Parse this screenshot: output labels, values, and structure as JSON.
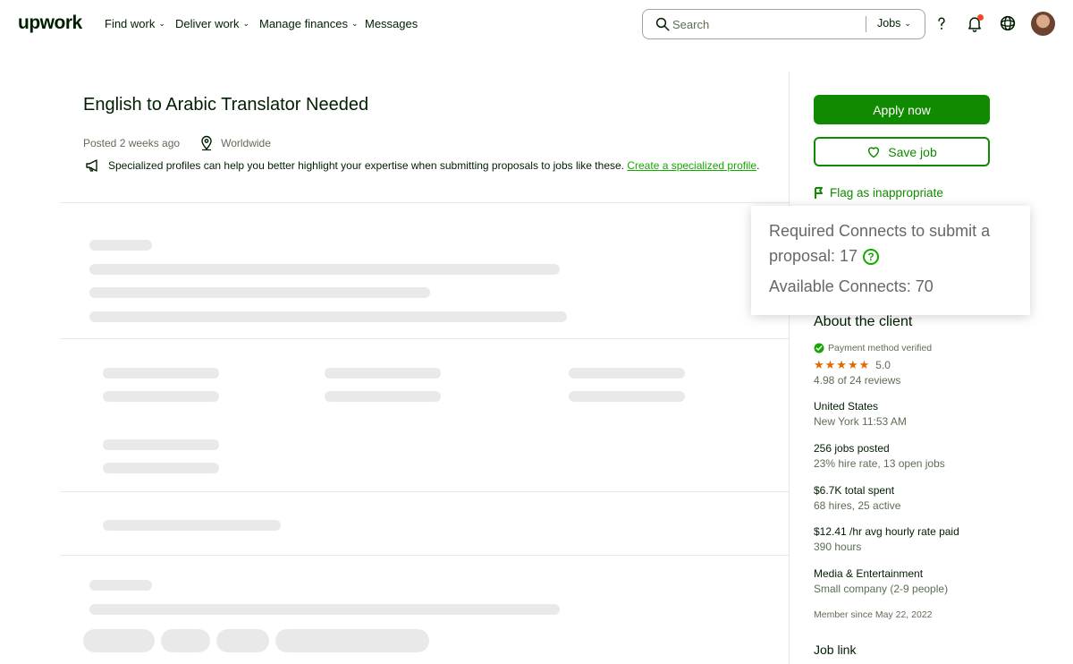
{
  "nav": {
    "logo": "upwork",
    "items": [
      "Find work",
      "Deliver work",
      "Manage finances",
      "Messages"
    ],
    "search_placeholder": "Search",
    "search_scope": "Jobs"
  },
  "job": {
    "title": "English to Arabic Translator Needed",
    "posted": "Posted 2 weeks ago",
    "location": "Worldwide",
    "promo_text": "Specialized profiles can help you better highlight your expertise when submitting proposals to jobs like these.",
    "promo_link": "Create a specialized profile",
    "promo_end": "."
  },
  "sidebar": {
    "apply_label": "Apply now",
    "save_label": "Save job",
    "flag_label": "Flag as inappropriate",
    "tooltip": {
      "required_text": "Required Connects to submit a proposal: 17",
      "help_glyph": "?",
      "available_text": "Available Connects: 70"
    },
    "about_title": "About the client",
    "payment_verified": "Payment method verified",
    "rating_value": "5.0",
    "rating_stars": 5,
    "reviews": "4.98 of 24 reviews",
    "location_country": "United States",
    "location_time": "New York 11:53 AM",
    "jobs_posted": "256 jobs posted",
    "hire_rate": "23% hire rate, 13 open jobs",
    "total_spent": "$6.7K total spent",
    "hires": "68 hires, 25 active",
    "avg_rate": "$12.41 /hr avg hourly rate paid",
    "hours": "390 hours",
    "industry": "Media & Entertainment",
    "company_size": "Small company (2-9 people)",
    "member_since": "Member since May 22, 2022",
    "job_link_title": "Job link"
  },
  "colors": {
    "brand_green": "#108a00",
    "link_green": "#14a800",
    "star_orange": "#e06a00",
    "notification_red": "#f04b23"
  }
}
